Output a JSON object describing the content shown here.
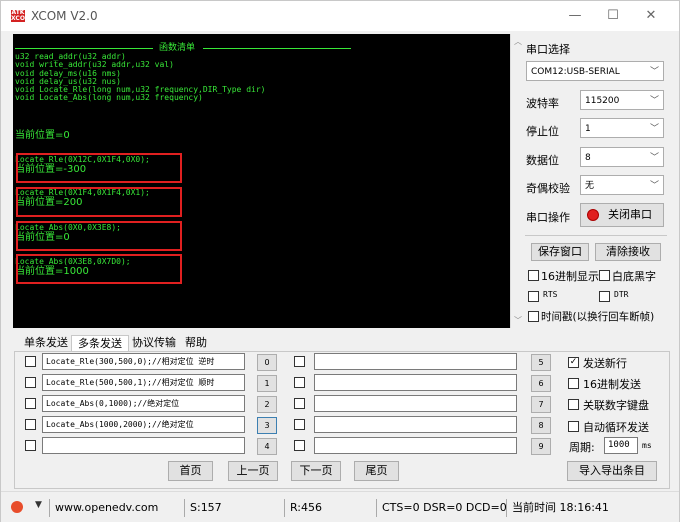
{
  "window": {
    "logo_text": "ATK\nXCOM",
    "title": "XCOM V2.0",
    "minimize": "—",
    "maximize": "☐",
    "close": "✕"
  },
  "terminal": {
    "header_title": "函数清单",
    "functions": [
      "u32 read_addr(u32 addr)",
      "void write_addr(u32 addr,u32 val)",
      "void delay_ms(u16 nms)",
      "void delay_us(u32 nus)",
      "void Locate_Rle(long num,u32 frequency,DIR_Type dir)",
      "void Locate_Abs(long num,u32 frequency)"
    ],
    "initial_position": "当前位置=0",
    "blocks": [
      {
        "call": "Locate_Rle(0X12C,0X1F4,0X0);",
        "result": "当前位置=-300"
      },
      {
        "call": "Locate_Rle(0X1F4,0X1F4,0X1);",
        "result": "当前位置=200"
      },
      {
        "call": "Locate_Abs(0X0,0X3E8);",
        "result": "当前位置=0"
      },
      {
        "call": "Locate_Abs(0X3E8,0X7D0);",
        "result": "当前位置=1000"
      }
    ]
  },
  "serial": {
    "port_select_label": "串口选择",
    "port_value": "COM12:USB-SERIAL",
    "baud_label": "波特率",
    "baud_value": "115200",
    "stopbits_label": "停止位",
    "stopbits_value": "1",
    "databits_label": "数据位",
    "databits_value": "8",
    "parity_label": "奇偶校验",
    "parity_value": "无",
    "operation_label": "串口操作",
    "close_port_label": "关闭串口",
    "save_window_label": "保存窗口",
    "clear_recv_label": "清除接收",
    "hex_display_label": "16进制显示",
    "white_bg_label": "白底黑字",
    "rts_label": "RTS",
    "dtr_label": "DTR",
    "timestamp_label": "时间戳(以换行回车断帧)"
  },
  "tabs": [
    "单条发送",
    "多条发送",
    "协议传输",
    "帮助"
  ],
  "multi_send": {
    "rows": [
      {
        "text": "Locate_Rle(300,500,0);//相对定位 逆时",
        "num": "0"
      },
      {
        "text": "Locate_Rle(500,500,1);//相对定位 顺时",
        "num": "1"
      },
      {
        "text": "Locate_Abs(0,1000);//绝对定位",
        "num": "2"
      },
      {
        "text": "Locate_Abs(1000,2000);//绝对定位",
        "num": "3"
      },
      {
        "text": "",
        "num": "4"
      }
    ],
    "right_nums": [
      "5",
      "6",
      "7",
      "8",
      "9"
    ],
    "send_newline_label": "发送新行",
    "hex_send_label": "16进制发送",
    "num_keypad_label": "关联数字键盘",
    "auto_loop_label": "自动循环发送",
    "period_label": "周期:",
    "period_value": "1000",
    "period_unit": "ms",
    "first_page": "首页",
    "prev_page": "上一页",
    "next_page": "下一页",
    "last_page": "尾页",
    "import_export": "导入导出条目"
  },
  "status": {
    "url": "www.openedv.com",
    "sent": "S:157",
    "received": "R:456",
    "lines": "CTS=0 DSR=0 DCD=0",
    "time": "当前时间 18:16:41"
  },
  "colors": {
    "terminal_bg": "#000000",
    "terminal_text": "#38e838",
    "highlight_box": "#e02020"
  }
}
